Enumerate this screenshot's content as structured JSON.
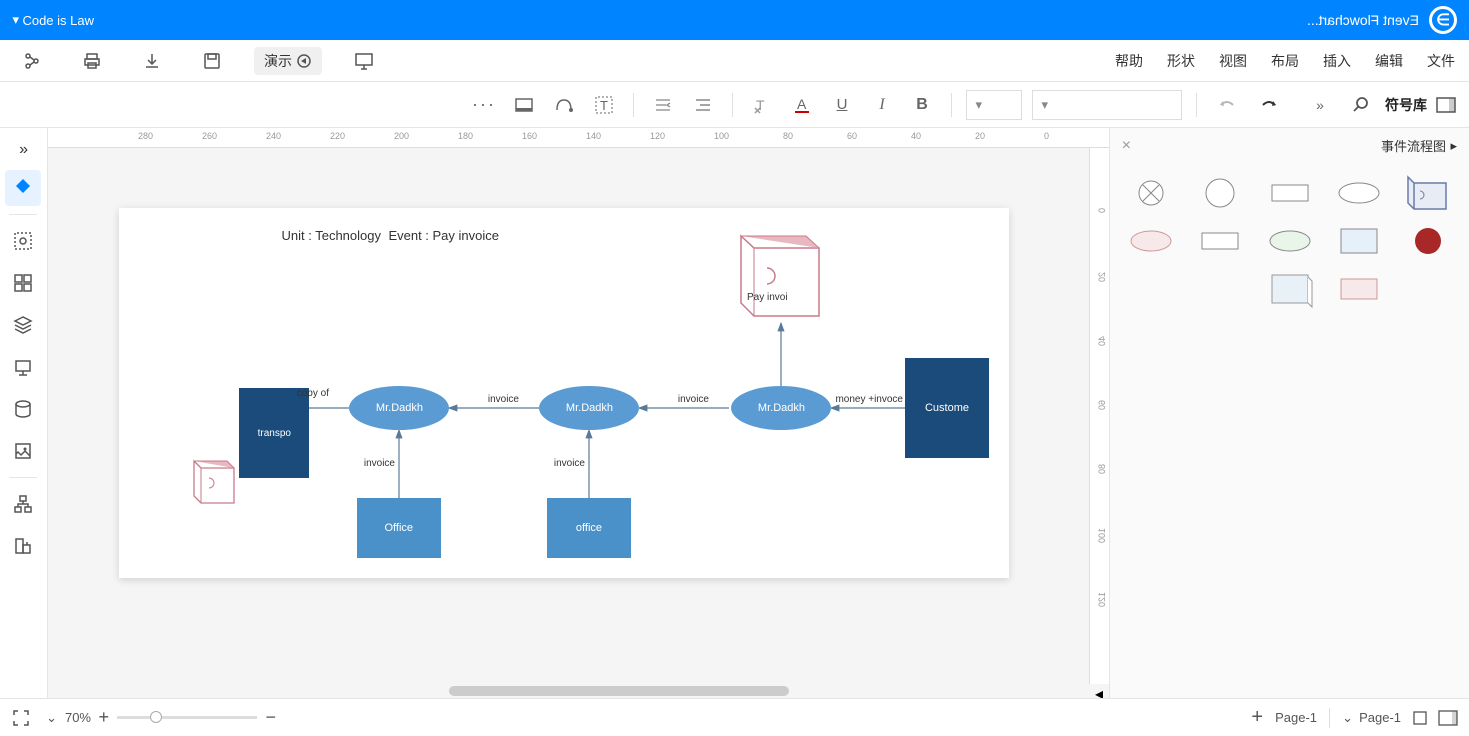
{
  "titlebar": {
    "doc_title": "Event Flowchart...",
    "user": "Code is Law"
  },
  "menubar": {
    "items": [
      "文件",
      "编辑",
      "插入",
      "布局",
      "视图",
      "形状",
      "帮助"
    ],
    "demo_label": "演示"
  },
  "toolbar": {
    "symbol_lib": "符号库"
  },
  "shape_panel": {
    "title": "事件流程图"
  },
  "canvas": {
    "title_line1": "Event : Pay invoice",
    "title_line2": "Unit : Technology",
    "nodes": {
      "customer": "Custome",
      "mr1": "Mr.Dadkh",
      "mr2": "Mr.Dadkh",
      "mr3": "Mr.Dadkh",
      "office1": "office",
      "office2": "Office",
      "transpo": "transpo",
      "payinv": "Pay invoi"
    },
    "edges": {
      "e1": "money +invoce",
      "e2": "invoice",
      "e3": "invoice",
      "e4": "invoice",
      "e5": "invoice",
      "e6": "copy of"
    }
  },
  "ruler": {
    "h": [
      "0",
      "20",
      "40",
      "60",
      "80",
      "100",
      "120",
      "140",
      "160",
      "180",
      "200",
      "220",
      "240",
      "260",
      "280"
    ],
    "v": [
      "0",
      "20",
      "40",
      "60",
      "80",
      "100",
      "120"
    ]
  },
  "statusbar": {
    "page_label": "Page-1",
    "page_current": "Page-1",
    "zoom": "70%"
  }
}
